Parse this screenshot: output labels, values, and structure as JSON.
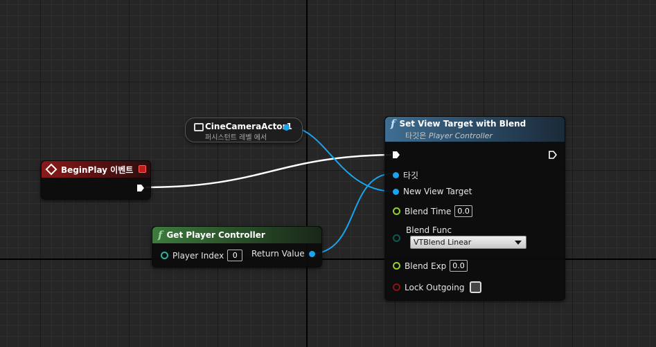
{
  "colors": {
    "exec_wire": "#ffffff",
    "object_wire": "#1aa4f0",
    "event_header": "#8a1a1a",
    "pure_func_header": "#3e7a3e",
    "func_header": "#3f6e92"
  },
  "begin_play": {
    "title": "BeginPlay 이벤트",
    "icon": "event-diamond-icon"
  },
  "camera_ref": {
    "title": "CineCameraActor1",
    "subtitle": "퍼시스턴트 레벨 에서",
    "icon": "camera-actor-icon"
  },
  "get_player_controller": {
    "icon_glyph": "f",
    "title": "Get Player Controller",
    "player_index_label": "Player Index",
    "player_index_value": "0",
    "return_label": "Return Value"
  },
  "set_view_target": {
    "icon_glyph": "f",
    "title": "Set View Target with Blend",
    "subtitle_prefix": "타깃은",
    "subtitle_class": "Player Controller",
    "target_label": "타깃",
    "new_view_target_label": "New View Target",
    "blend_time_label": "Blend Time",
    "blend_time_value": "0.0",
    "blend_func_label": "Blend Func",
    "blend_func_value": "VTBlend Linear",
    "blend_exp_label": "Blend Exp",
    "blend_exp_value": "0.0",
    "lock_outgoing_label": "Lock Outgoing",
    "lock_outgoing_checked": false
  }
}
